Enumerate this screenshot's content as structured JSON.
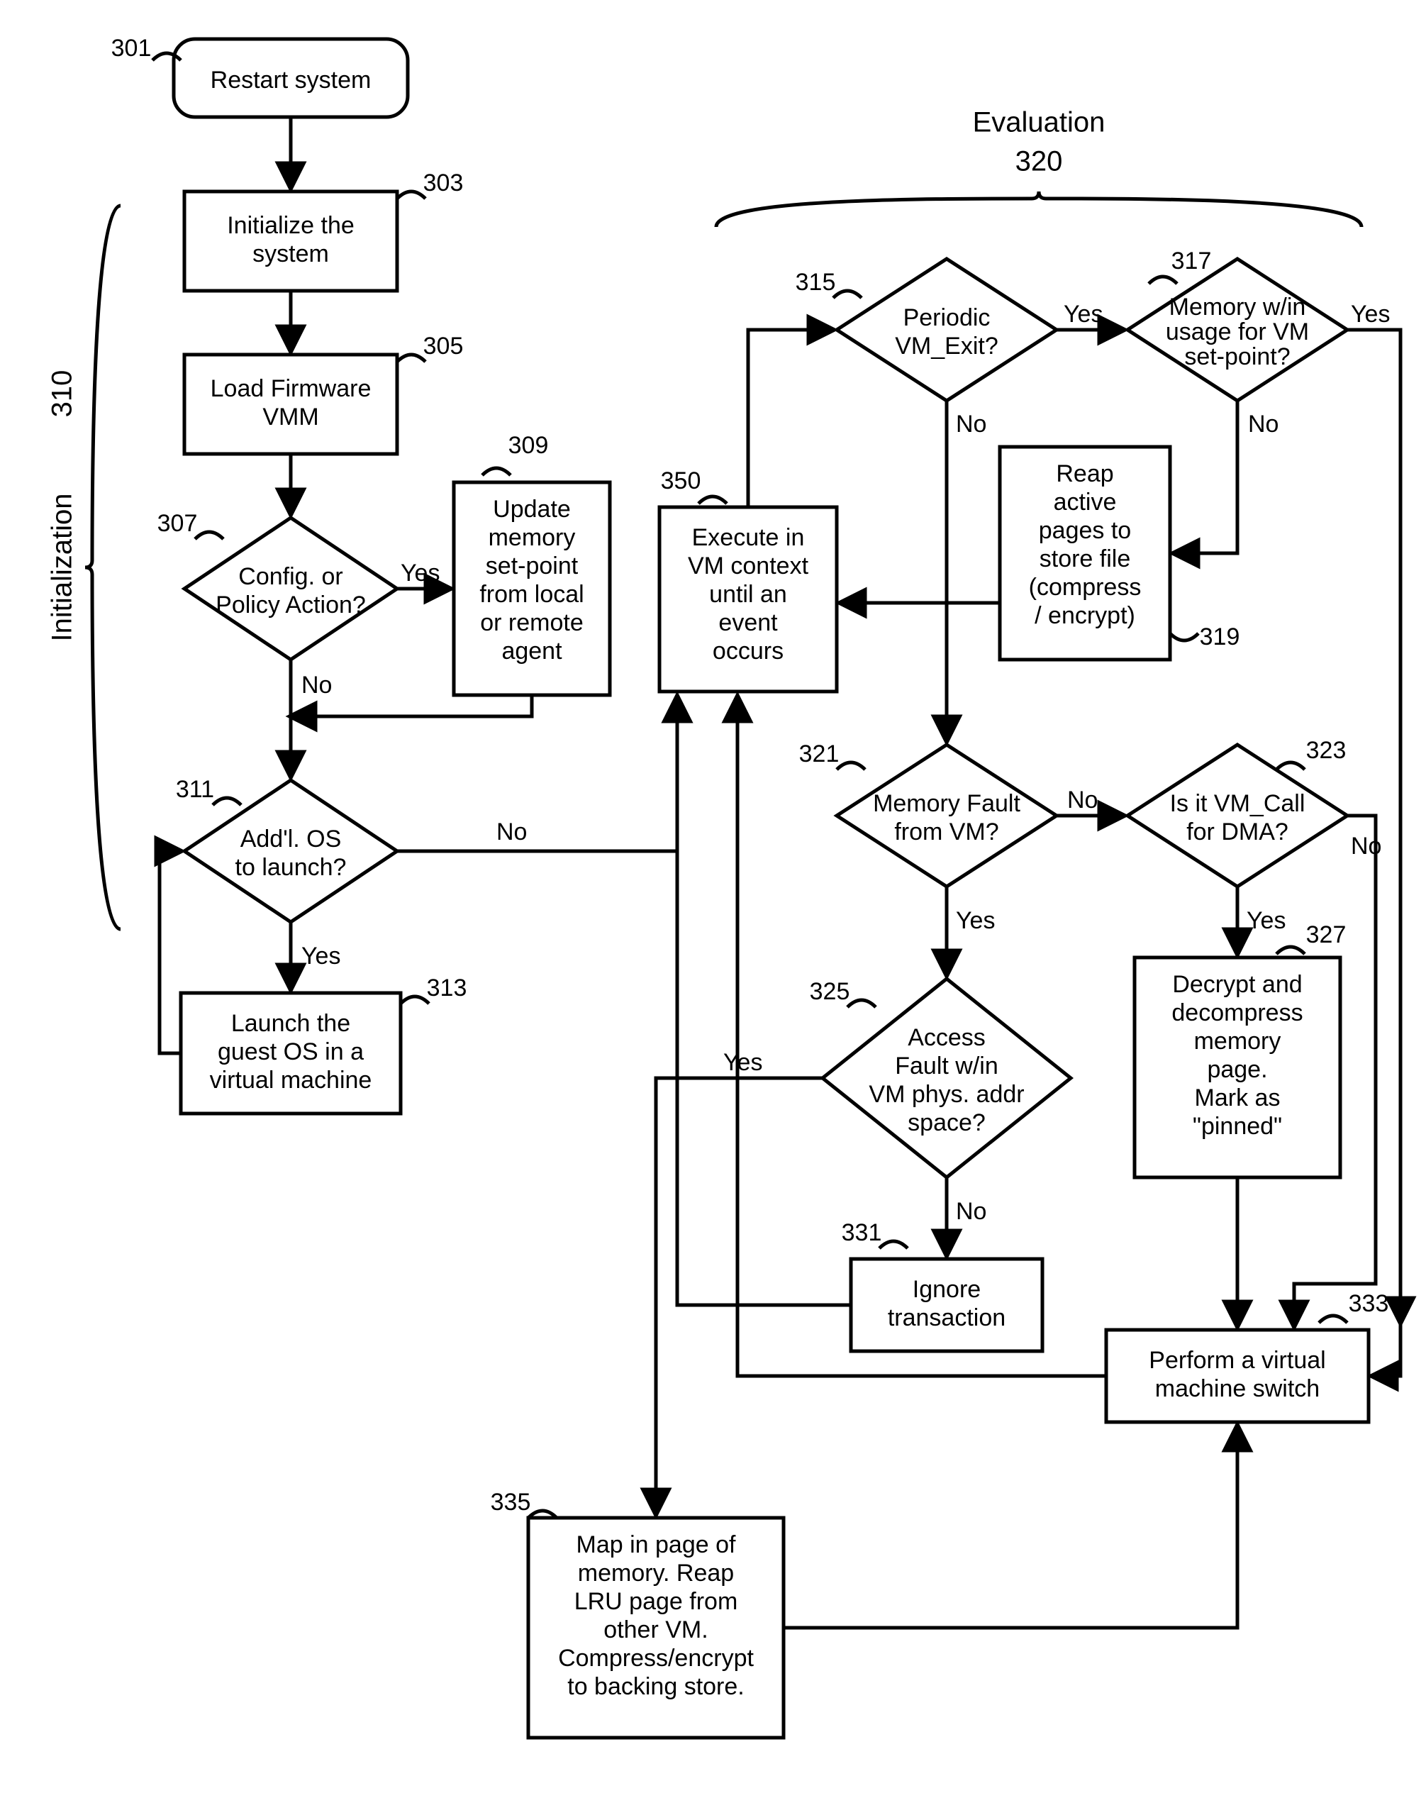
{
  "labels": {
    "section_init": "Initialization",
    "section_init_num": "310",
    "section_eval": "Evaluation",
    "section_eval_num": "320",
    "n301": "301",
    "t301": "Restart system",
    "n303": "303",
    "t303a": "Initialize the",
    "t303b": "system",
    "n305": "305",
    "t305a": "Load Firmware",
    "t305b": "VMM",
    "n307": "307",
    "t307a": "Config. or",
    "t307b": "Policy Action?",
    "n309": "309",
    "t309a": "Update",
    "t309b": "memory",
    "t309c": "set-point",
    "t309d": "from local",
    "t309e": "or remote",
    "t309f": "agent",
    "n311": "311",
    "t311a": "Add'l. OS",
    "t311b": "to launch?",
    "n313": "313",
    "t313a": "Launch the",
    "t313b": "guest OS in a",
    "t313c": "virtual machine",
    "n315": "315",
    "t315a": "Periodic",
    "t315b": "VM_Exit?",
    "n317": "317",
    "t317a": "Memory w/in",
    "t317b": "usage for VM",
    "t317c": "set-point?",
    "n319": "319",
    "t319a": "Reap",
    "t319b": "active",
    "t319c": "pages to",
    "t319d": "store file",
    "t319e": "(compress",
    "t319f": "/ encrypt)",
    "n350": "350",
    "t350a": "Execute in",
    "t350b": "VM context",
    "t350c": "until an",
    "t350d": "event",
    "t350e": "occurs",
    "n321": "321",
    "t321a": "Memory Fault",
    "t321b": "from VM?",
    "n323": "323",
    "t323a": "Is it VM_Call",
    "t323b": "for DMA?",
    "n325": "325",
    "t325a": "Access",
    "t325b": "Fault w/in",
    "t325c": "VM phys. addr",
    "t325d": "space?",
    "n327": "327",
    "t327a": "Decrypt and",
    "t327b": "decompress",
    "t327c": "memory",
    "t327d": "page.",
    "t327e": "Mark as",
    "t327f": "\"pinned\"",
    "n331": "331",
    "t331a": "Ignore",
    "t331b": "transaction",
    "n333": "333",
    "t333a": "Perform a virtual",
    "t333b": "machine switch",
    "n335": "335",
    "t335a": "Map in page of",
    "t335b": "memory.  Reap",
    "t335c": "LRU page from",
    "t335d": "other VM.",
    "t335e": "Compress/encrypt",
    "t335f": "to backing store.",
    "yes": "Yes",
    "no": "No"
  }
}
